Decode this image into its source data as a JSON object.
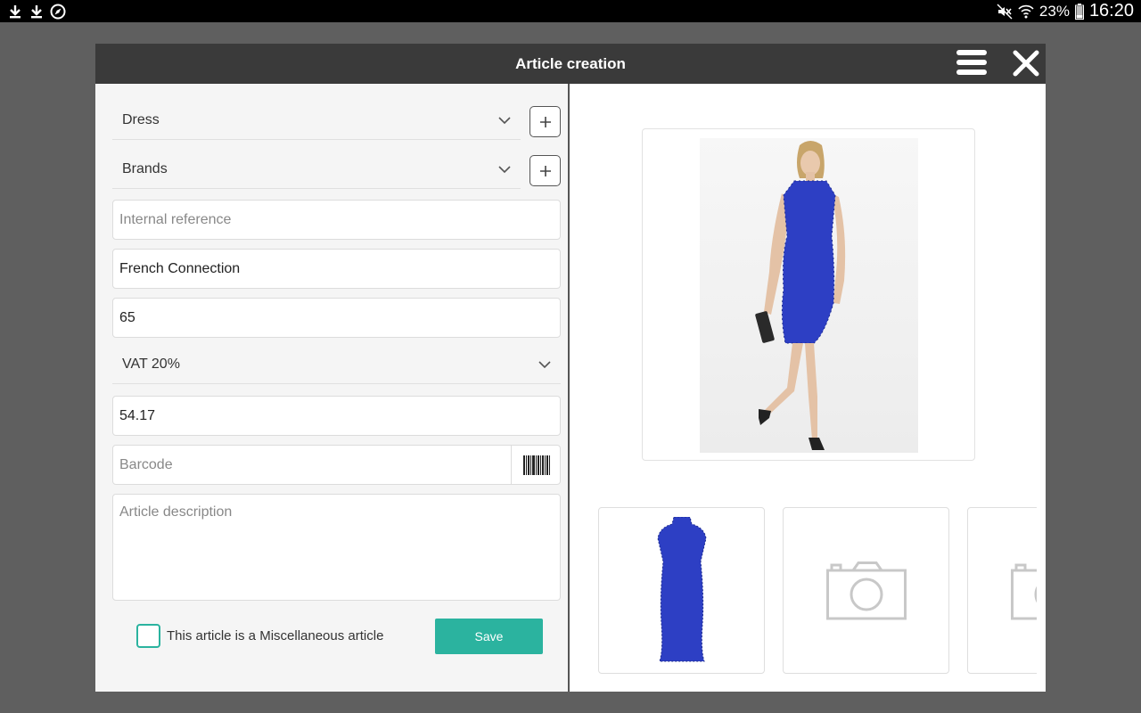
{
  "status_bar": {
    "left_icons": [
      "download-icon",
      "download-icon",
      "compass-icon"
    ],
    "right_icons": [
      "mute-icon",
      "wifi-icon",
      "battery-icon"
    ],
    "battery": "23%",
    "time": "16:20"
  },
  "dialog": {
    "title": "Article creation",
    "menu_icon": "hamburger-menu-icon",
    "close_icon": "close-icon"
  },
  "form": {
    "category": "Dress",
    "brand": "Brands",
    "internal_reference_placeholder": "Internal reference",
    "name_value": "French Connection",
    "price_value": "65",
    "vat": "VAT 20%",
    "price_excl_value": "54.17",
    "barcode_placeholder": "Barcode",
    "description_placeholder": "Article description",
    "misc_label": "This article is a Miscellaneous article",
    "misc_checked": false,
    "save_label": "Save"
  },
  "colors": {
    "accent": "#2bb39f",
    "titlebar": "#3a3a3a",
    "dress_blue": "#2d3fc4"
  },
  "photos": {
    "main": "photo of model wearing blue lace dress",
    "thumbnails": [
      "blue-lace-dress",
      "camera-placeholder",
      "camera-placeholder"
    ]
  }
}
